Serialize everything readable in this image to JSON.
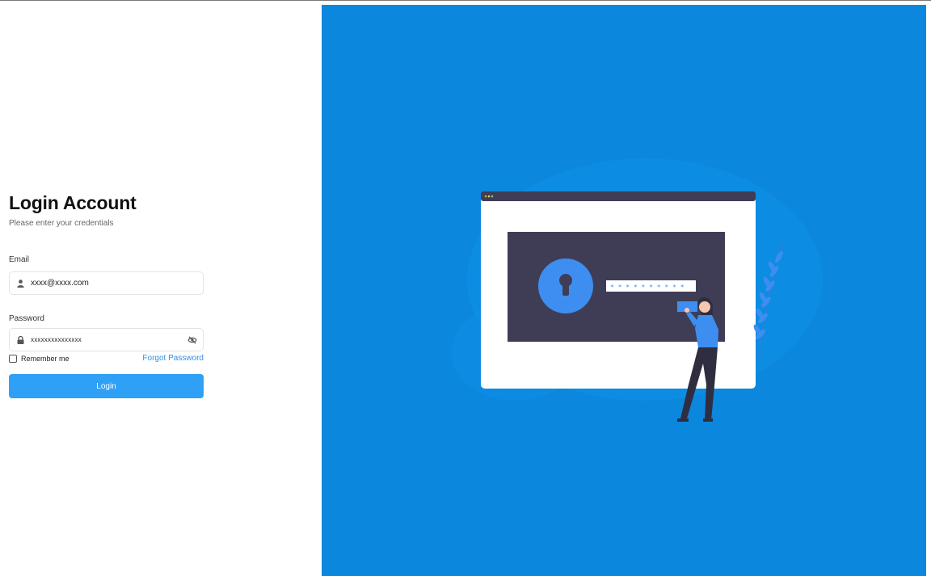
{
  "login": {
    "title": "Login Account",
    "subtitle": "Please enter your credentials",
    "email": {
      "label": "Email",
      "value": "xxxx@xxxx.com",
      "icon": "user-icon"
    },
    "password": {
      "label": "Password",
      "value": "xxxxxxxxxxxxxxx",
      "icon": "lock-icon",
      "toggle_icon": "eye-off-icon"
    },
    "remember_label": "Remember me",
    "forgot_label": "Forgot Password",
    "submit_label": "Login"
  },
  "illustration": {
    "masked_password": "* * * * * * * * * *"
  },
  "colors": {
    "panel_blue": "#0b87de",
    "button_blue": "#2ea1f6",
    "link_blue": "#2f8fe3",
    "accent_blue": "#3d8ef0",
    "dark_screen": "#3f3d56"
  }
}
